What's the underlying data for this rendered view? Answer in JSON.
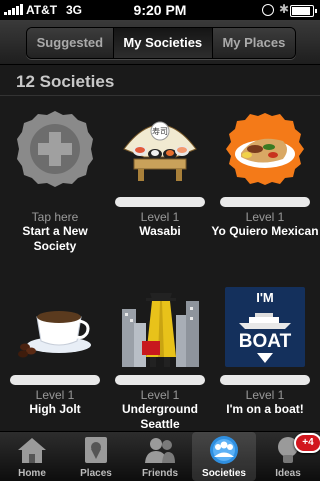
{
  "status_bar": {
    "carrier": "AT&T",
    "network": "3G",
    "time": "9:20 PM",
    "battery_level": 0.9
  },
  "tabs": [
    {
      "label": "Suggested",
      "active": false
    },
    {
      "label": "My Societies",
      "active": true
    },
    {
      "label": "My Places",
      "active": false
    }
  ],
  "societies_count": "12 Societies",
  "societies": [
    {
      "level": "Tap here",
      "name": "Start a New Society",
      "icon": "add-icon"
    },
    {
      "level": "Level 1",
      "name": "Wasabi",
      "icon": "sushi-icon"
    },
    {
      "level": "Level 1",
      "name": "Yo Quiero Mexican",
      "icon": "burrito-icon"
    },
    {
      "level": "Level 1",
      "name": "High Jolt",
      "icon": "coffee-icon"
    },
    {
      "level": "Level 1",
      "name": "Underground Seattle",
      "icon": "detective-city-icon"
    },
    {
      "level": "Level 1",
      "name": "I'm on a boat!",
      "icon": "boat-icon",
      "art_lines": [
        "I'M",
        "BOAT"
      ]
    }
  ],
  "tab_bar": {
    "items": [
      {
        "label": "Home",
        "icon": "home-icon"
      },
      {
        "label": "Places",
        "icon": "places-icon"
      },
      {
        "label": "Friends",
        "icon": "friends-icon"
      },
      {
        "label": "Societies",
        "icon": "societies-icon",
        "active": true
      },
      {
        "label": "Ideas",
        "icon": "ideas-icon",
        "badge": "+4"
      }
    ]
  },
  "colors": {
    "background": "#1a1a1a",
    "badge": "#d2161e",
    "active_tab_highlight": "#3a3a3a"
  }
}
